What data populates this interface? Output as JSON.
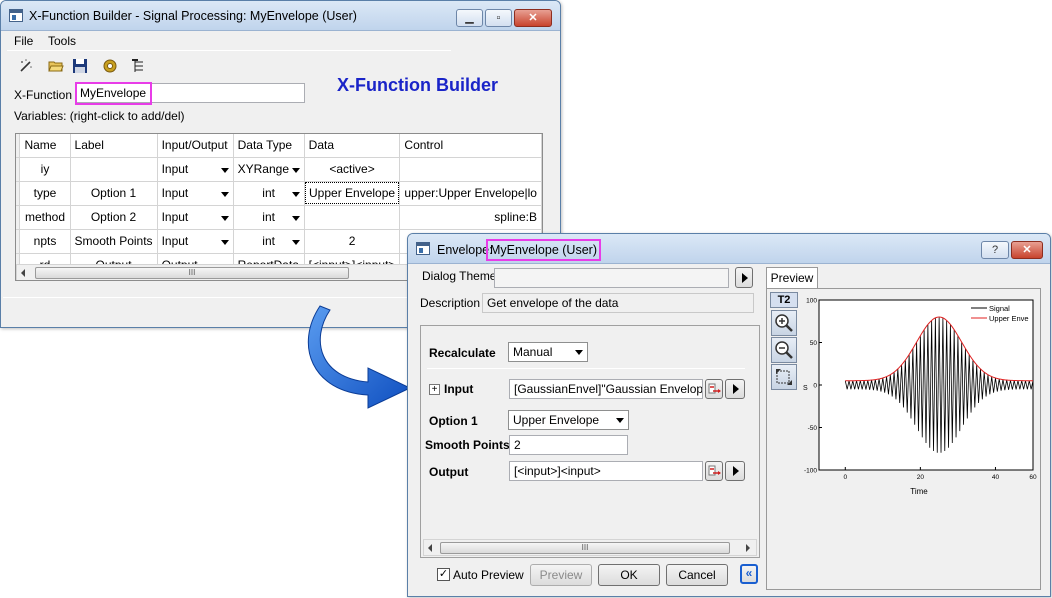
{
  "xfb": {
    "title": "X-Function Builder - Signal Processing: MyEnvelope (User)",
    "menu": [
      "File",
      "Tools"
    ],
    "header_text": "X-Function Builder",
    "xfunction_label": "X-Function",
    "xfunction_value": "MyEnvelope",
    "variables_hint": "Variables: (right-click to add/del)",
    "columns": [
      "Name",
      "Label",
      "Input/Output",
      "Data Type",
      "Data",
      "Control"
    ],
    "rows": [
      {
        "name": "iy",
        "label": "",
        "io": "Input",
        "type": "XYRange",
        "data": "<active>",
        "control": ""
      },
      {
        "name": "type",
        "label": "Option 1",
        "io": "Input",
        "type": "int",
        "data": "Upper Envelope",
        "control": "upper:Upper Envelope|lo"
      },
      {
        "name": "method",
        "label": "Option 2",
        "io": "Input",
        "type": "int",
        "data": "",
        "control": "spline:B"
      },
      {
        "name": "npts",
        "label": "Smooth Points",
        "io": "Input",
        "type": "int",
        "data": "2",
        "control": ""
      },
      {
        "name": "rd",
        "label": "Output",
        "io": "Output",
        "type": "ReportData",
        "data": "[<input>]<input>",
        "control": ""
      }
    ],
    "scroll_grip": "III"
  },
  "env": {
    "title_prefix": "Envelope:",
    "title_highlight": "MyEnvelope (User)",
    "help_label": "?",
    "dialog_theme_label": "Dialog Theme",
    "dialog_theme_value": "",
    "description_label": "Description",
    "description_value": "Get envelope of the data",
    "recalculate_label": "Recalculate",
    "recalculate_value": "Manual",
    "input_expand": "+",
    "input_label": "Input",
    "input_value": "[GaussianEnvel]\"Gaussian Envelope\"!(A",
    "option1_label": "Option 1",
    "option1_value": "Upper Envelope",
    "smooth_label": "Smooth Points",
    "smooth_value": "2",
    "output_label": "Output",
    "output_value": "[<input>]<input>",
    "scroll_grip": "III",
    "auto_preview_label": "Auto Preview",
    "auto_preview_checked": true,
    "preview_btn": "Preview",
    "ok_btn": "OK",
    "cancel_btn": "Cancel",
    "collapse_btn": "«",
    "preview_tab": "Preview",
    "t2_label": "T2"
  },
  "chart_data": {
    "type": "line",
    "title": "",
    "xlabel": "Time",
    "ylabel": "S",
    "xlim": [
      -7,
      50
    ],
    "ylim": [
      -100,
      100
    ],
    "xticks": [
      0,
      20,
      40,
      60
    ],
    "xtick_labels": [
      "0",
      "20",
      "40",
      "60"
    ],
    "yticks": [
      -100,
      -50,
      0,
      50,
      100
    ],
    "legend": [
      "Signal",
      "Upper Enve"
    ],
    "legend_position": "top-right",
    "series": [
      {
        "name": "Signal",
        "color": "#000000",
        "description": "Gaussian-modulated oscillation centered at x=25, amplitude ~80, base amplitude ~5, sampled x 0 to 50"
      },
      {
        "name": "Upper Enve",
        "color": "#ff0000",
        "description": "Upper envelope of the signal"
      }
    ],
    "signal": {
      "center": 25,
      "peak": 80,
      "width": 6,
      "base": 5,
      "start": 0,
      "end": 50,
      "step": 0.5
    }
  },
  "arrow_color": "#1a5fd0",
  "highlight_color": "#e83ce8",
  "title_color": "#1a24c8"
}
